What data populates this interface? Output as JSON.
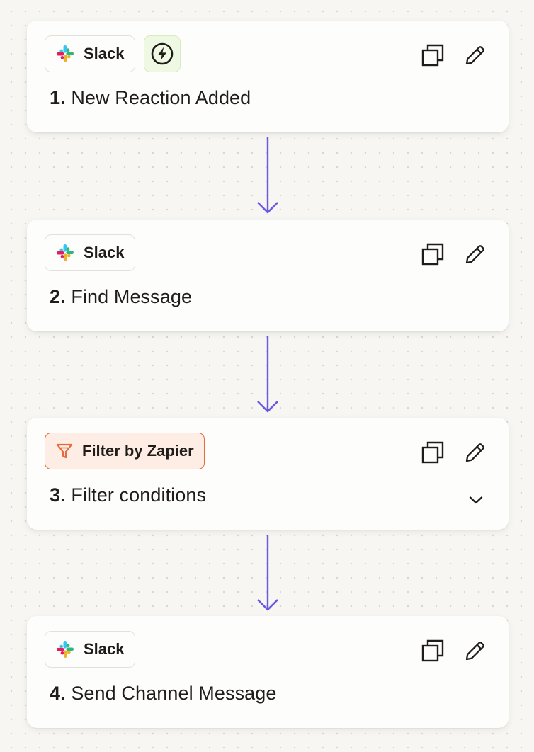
{
  "colors": {
    "canvas_background": "#f7f6f3",
    "card_background": "#fdfdfb",
    "connector": "#6a5ae0",
    "trigger_badge_bg": "#eef8e2",
    "filter_accent": "#e86a3c"
  },
  "steps": [
    {
      "number": "1.",
      "title": "New Reaction Added",
      "app": "Slack",
      "app_icon": "slack-logo-icon",
      "trigger_icon": "lightning-bolt-icon",
      "actions": [
        "duplicate-icon",
        "pencil-edit-icon"
      ]
    },
    {
      "number": "2.",
      "title": "Find Message",
      "app": "Slack",
      "app_icon": "slack-logo-icon",
      "actions": [
        "duplicate-icon",
        "pencil-edit-icon"
      ]
    },
    {
      "number": "3.",
      "title": "Filter conditions",
      "app": "Filter by Zapier",
      "app_icon": "filter-funnel-icon",
      "expand_icon": "chevron-down-icon",
      "actions": [
        "duplicate-icon",
        "pencil-edit-icon"
      ]
    },
    {
      "number": "4.",
      "title": "Send Channel Message",
      "app": "Slack",
      "app_icon": "slack-logo-icon",
      "actions": [
        "duplicate-icon",
        "pencil-edit-icon"
      ]
    }
  ]
}
